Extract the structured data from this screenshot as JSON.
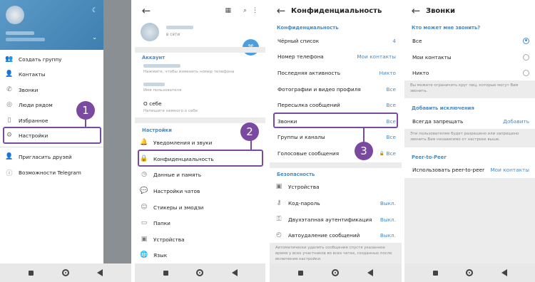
{
  "drawer": {
    "menu": [
      {
        "label": "Создать группу",
        "icon": "group-icon"
      },
      {
        "label": "Контакты",
        "icon": "contact-icon"
      },
      {
        "label": "Звонки",
        "icon": "phone-icon"
      },
      {
        "label": "Люди рядом",
        "icon": "people-nearby-icon"
      },
      {
        "label": "Избранное",
        "icon": "bookmark-icon"
      },
      {
        "label": "Настройки",
        "icon": "gear-icon"
      },
      {
        "label": "Пригласить друзей",
        "icon": "add-user-icon"
      },
      {
        "label": "Возможности Telegram",
        "icon": "help-icon"
      }
    ],
    "badge": "1"
  },
  "settings": {
    "status": "в сети",
    "account_header": "Аккаунт",
    "phone_hint": "Нажмите, чтобы изменить номер телефона",
    "username_hint": "Имя пользователя",
    "about_label": "О себе",
    "about_hint": "Напишите немного о себе",
    "settings_header": "Настройки",
    "items": [
      {
        "label": "Уведомления и звуки",
        "icon": "bell-icon"
      },
      {
        "label": "Конфиденциальность",
        "icon": "lock-icon"
      },
      {
        "label": "Данные и память",
        "icon": "clock-icon"
      },
      {
        "label": "Настройки чатов",
        "icon": "chat-icon"
      },
      {
        "label": "Стикеры и эмодзи",
        "icon": "sticker-icon"
      },
      {
        "label": "Папки",
        "icon": "folder-icon"
      },
      {
        "label": "Устройства",
        "icon": "devices-icon"
      },
      {
        "label": "Язык",
        "icon": "globe-icon"
      }
    ],
    "badge": "2"
  },
  "privacy": {
    "title": "Конфиденциальность",
    "section": "Конфиденциальность",
    "rows": [
      {
        "label": "Чёрный список",
        "value": "4"
      },
      {
        "label": "Номер телефона",
        "value": "Мои контакты"
      },
      {
        "label": "Последняя активность",
        "value": "Никто"
      },
      {
        "label": "Фотографии и видео профиля",
        "value": "Все"
      },
      {
        "label": "Пересылка сообщений",
        "value": "Все"
      },
      {
        "label": "Звонки",
        "value": "Все"
      },
      {
        "label": "Группы и каналы",
        "value": "Все"
      },
      {
        "label": "Голосовые сообщения",
        "value": "Все"
      }
    ],
    "security_header": "Безопасность",
    "security": [
      {
        "label": "Устройства",
        "value": "",
        "icon": "devices-icon"
      },
      {
        "label": "Код-пароль",
        "value": "Выкл.",
        "icon": "key-icon"
      },
      {
        "label": "Двухэтапная аутентификация",
        "value": "Выкл.",
        "icon": "shield-key-icon"
      },
      {
        "label": "Автоудаление сообщений",
        "value": "Выкл.",
        "icon": "timer-icon"
      }
    ],
    "note": "Автоматически удалять сообщения спустя указанное время у всех участников во всех чатах, созданных после включения настройки.",
    "badge": "3"
  },
  "calls": {
    "title": "Звонки",
    "who_header": "Кто может мне звонить?",
    "options": [
      {
        "label": "Все",
        "selected": true
      },
      {
        "label": "Мои контакты",
        "selected": false
      },
      {
        "label": "Никто",
        "selected": false
      }
    ],
    "who_note": "Вы можете ограничить круг лиц, которые могут Вам звонить.",
    "exceptions_header": "Добавить исключения",
    "always_deny": "Всегда запрещать",
    "add": "Добавить",
    "exceptions_note": "Эти пользователям будет разрешено или запрещено звонить Вам независимо от настроек выше.",
    "p2p_header": "Peer-to-Peer",
    "p2p_label": "Использовать peer-to-peer",
    "p2p_value": "Мои контакты"
  },
  "colors": {
    "accent": "#4a8ac2",
    "callout": "#7a4aa0",
    "drawer_header": "#4f8fbf"
  }
}
